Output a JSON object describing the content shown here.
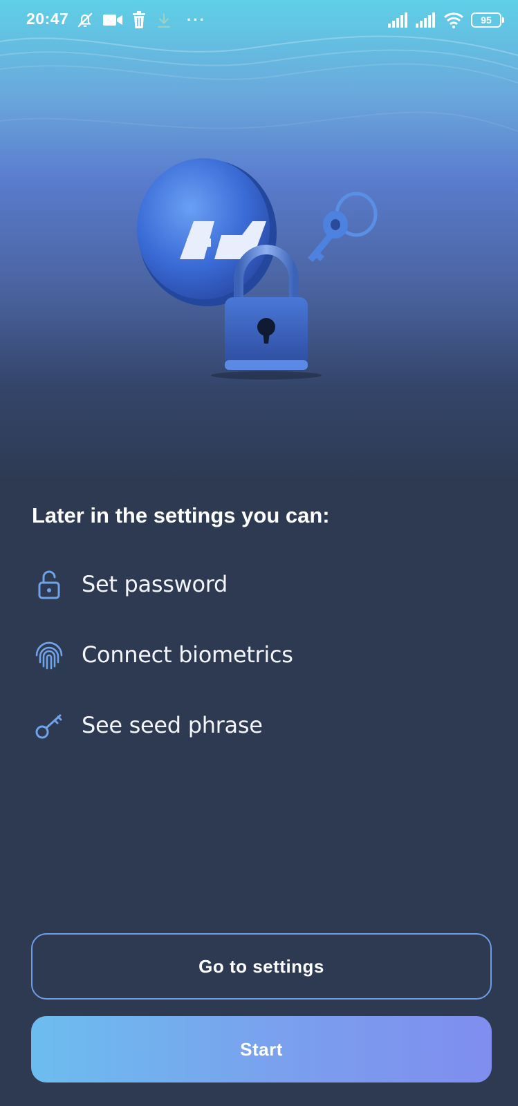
{
  "status_bar": {
    "time": "20:47",
    "battery_level": "95",
    "left_icons": [
      "bell-off-icon",
      "video-icon",
      "trash-icon",
      "download-icon",
      "more-dots-icon"
    ],
    "right_icons": [
      "signal-icon",
      "signal-icon",
      "wifi-icon",
      "battery-icon"
    ],
    "more_label": "···"
  },
  "hero": {
    "illustration": [
      "coin-logo-illustration",
      "padlock-illustration",
      "keys-illustration"
    ]
  },
  "content": {
    "title": "Later in the settings you can:",
    "features": [
      {
        "icon": "unlock-icon",
        "label": "Set password"
      },
      {
        "icon": "fingerprint-icon",
        "label": "Connect biometrics"
      },
      {
        "icon": "key-icon",
        "label": "See seed phrase"
      }
    ]
  },
  "actions": {
    "settings_label": "Go to settings",
    "start_label": "Start"
  },
  "colors": {
    "background": "#2d3a51",
    "accent": "#6f9ee8",
    "icon": "#6fa3ea",
    "start_gradient_from": "#6cbdef",
    "start_gradient_to": "#7f8def"
  }
}
